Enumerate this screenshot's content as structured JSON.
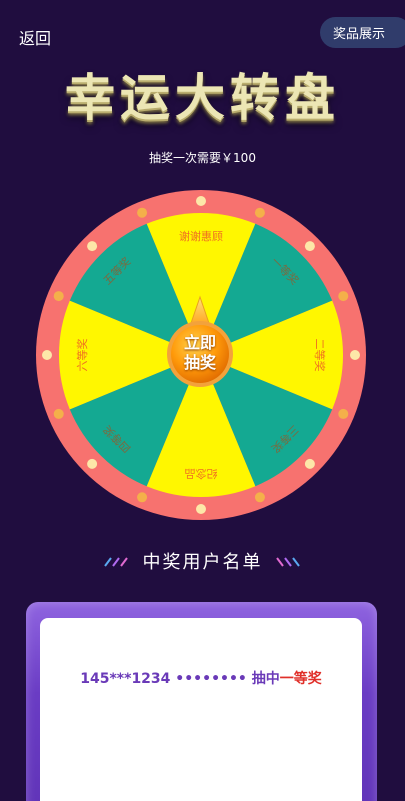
{
  "header": {
    "back_label": "返回",
    "prizes_label": "奖品展示"
  },
  "title": "幸运大转盘",
  "cost_text": "抽奖一次需要￥100",
  "wheel": {
    "segments": [
      {
        "label": "谢谢惠顾",
        "color": "#fff700"
      },
      {
        "label": "一等奖",
        "color": "#14a992"
      },
      {
        "label": "二等奖",
        "color": "#fff700"
      },
      {
        "label": "三等奖",
        "color": "#14a992"
      },
      {
        "label": "纪念品",
        "color": "#fff700"
      },
      {
        "label": "四等奖",
        "color": "#14a992"
      },
      {
        "label": "六等奖",
        "color": "#fff700"
      },
      {
        "label": "五等奖",
        "color": "#14a992"
      }
    ],
    "rim_color": "#f7726f",
    "start_label_line1": "立即",
    "start_label_line2": "抽奖"
  },
  "winners": {
    "title": "中奖用户名单",
    "rows": [
      {
        "phone": "145***1234",
        "dots": "••••••••",
        "action": "抽中",
        "prize": "一等奖"
      }
    ]
  },
  "colors": {
    "background": "#200d3f",
    "title": "#ece6b4",
    "panel": "#6a3cc4",
    "winner_text": "#6a3ab8",
    "prize_text": "#e0302a"
  }
}
